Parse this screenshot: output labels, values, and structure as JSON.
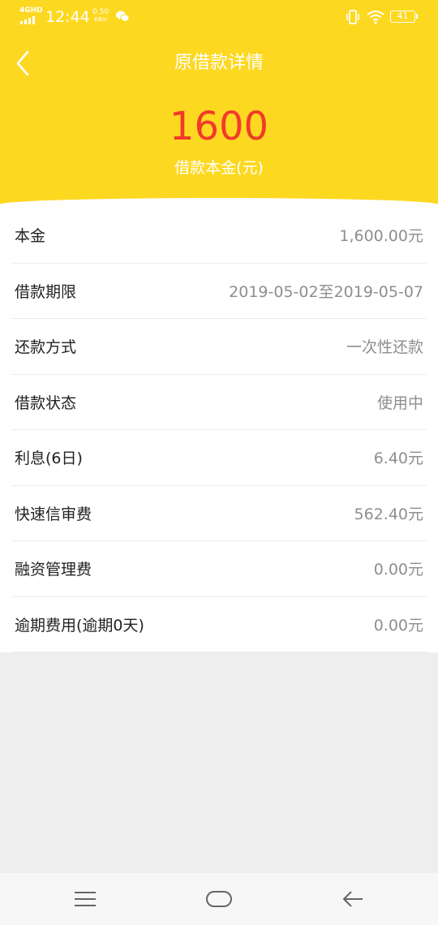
{
  "status_bar": {
    "network": "4GHD",
    "time": "12:44",
    "speed_value": "0.50",
    "speed_unit": "KB/s",
    "battery": "41"
  },
  "header": {
    "title": "原借款详情",
    "amount": "1600",
    "amount_label": "借款本金(元)"
  },
  "details": [
    {
      "label": "本金",
      "value": "1,600.00元"
    },
    {
      "label": "借款期限",
      "value": "2019-05-02至2019-05-07"
    },
    {
      "label": "还款方式",
      "value": "一次性还款"
    },
    {
      "label": "借款状态",
      "value": "使用中"
    },
    {
      "label": "利息(6日)",
      "value": "6.40元"
    },
    {
      "label": "快速信审费",
      "value": "562.40元"
    },
    {
      "label": "融资管理费",
      "value": "0.00元"
    },
    {
      "label": "逾期费用(逾期0天)",
      "value": "0.00元"
    }
  ],
  "colors": {
    "header_bg": "#fdd821",
    "amount": "#f23a2a",
    "page_bg": "#eeeeee"
  },
  "icons": {
    "back": "back-chevron-icon",
    "menu": "menu-icon",
    "home": "home-icon",
    "nav_back": "nav-back-arrow-icon"
  }
}
